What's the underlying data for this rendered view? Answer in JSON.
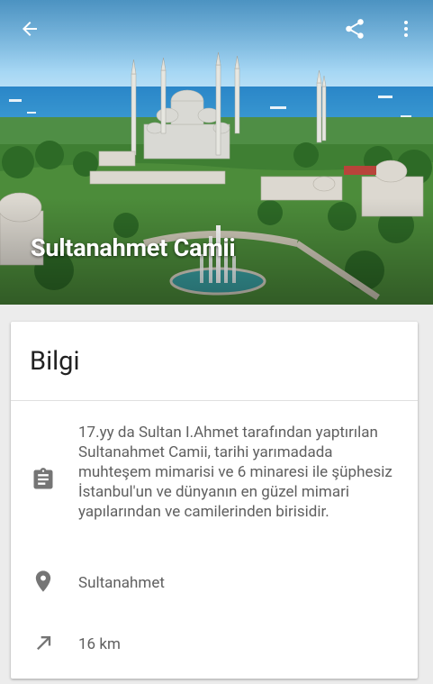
{
  "hero": {
    "title": "Sultanahmet Camii"
  },
  "toolbar": {
    "back_icon": "arrow-left-icon",
    "share_icon": "share-icon",
    "menu_icon": "more-vert-icon"
  },
  "card": {
    "title": "Bilgi",
    "description": "17.yy da Sultan I.Ahmet tarafından yaptırılan Sultanahmet Camii, tarihi yarımadada muhteşem mimarisi ve 6 minaresi ile şüphesiz İstanbul'un ve dünyanın en güzel mimari yapılarından ve camilerinden birisidir.",
    "description_icon": "clipboard-icon",
    "location": "Sultanahmet",
    "location_icon": "location-pin-icon",
    "distance": "16 km",
    "distance_icon": "arrow-north-east-icon"
  },
  "colors": {
    "icon_gray": "#757575",
    "text_gray": "#5f5f5f",
    "sky": "#7ec3ef",
    "sea": "#2f8fd0"
  }
}
